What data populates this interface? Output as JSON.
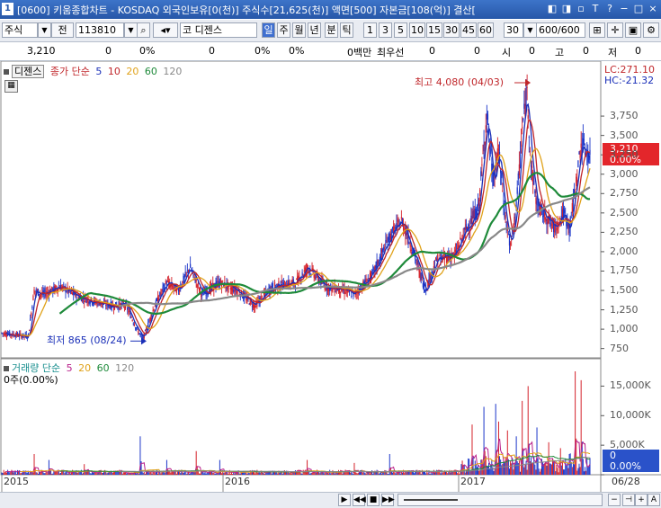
{
  "titlebar": {
    "number": "1",
    "title": "[0600] 키움종합차트 - KOSDAQ 외국인보유[0(천)] 주식수[21,625(천)] 액면[500] 자본금[108(억)] 결산[",
    "buttons": [
      "◧",
      "◨",
      "▫",
      "T",
      "?",
      "−",
      "□",
      "×"
    ]
  },
  "toolbar": {
    "market_select": "주식",
    "period_label": "전",
    "code": "113810",
    "stock_name": "코 디젠스",
    "intervals": [
      "일",
      "주",
      "월",
      "년",
      "분",
      "틱"
    ],
    "minutes": [
      "1",
      "3",
      "5",
      "10",
      "15",
      "30",
      "45",
      "60"
    ],
    "count_select": "30",
    "range": "600/600"
  },
  "infobar": {
    "price": "3,210",
    "v1": "0",
    "p1": "0%",
    "v2": "0",
    "p2": "0%",
    "p3": "0%",
    "unit": "0백만",
    "best_label": "최우선",
    "v3": "0",
    "v4": "0",
    "open_label": "시",
    "open_val": "0",
    "high_label": "고",
    "high_val": "0",
    "low_label": "저",
    "low_val": "0"
  },
  "price_panel": {
    "stock_tab": "디젠스",
    "legend_prefix": "종가 단순",
    "ma": [
      {
        "period": "5",
        "color": "#1a2fb8"
      },
      {
        "period": "10",
        "color": "#c0262a"
      },
      {
        "period": "20",
        "color": "#e0a21a"
      },
      {
        "period": "60",
        "color": "#1e8a3a"
      },
      {
        "period": "120",
        "color": "#888888"
      }
    ],
    "lc": "LC:271.10",
    "hc": "HC:-21.32",
    "current_price": "3,210",
    "current_pct": "0.00%",
    "high_note": "최고 4,080 (04/03)",
    "low_note": "최저 865 (08/24)"
  },
  "volume_panel": {
    "legend_prefix": "거래량 단순",
    "ma": [
      {
        "period": "5",
        "color": "#b81f8a"
      },
      {
        "period": "20",
        "color": "#e0a21a"
      },
      {
        "period": "60",
        "color": "#1e8a3a"
      },
      {
        "period": "120",
        "color": "#888888"
      }
    ],
    "current": "0주(0.00%)",
    "current_box": "0",
    "current_pct_box": "0.00%"
  },
  "xaxis": {
    "labels": [
      "2015",
      "2016",
      "2017"
    ],
    "last_date": "06/28"
  },
  "chart_data": {
    "type": "line",
    "price_ticks": [
      750,
      1000,
      1250,
      1500,
      1750,
      2000,
      2250,
      2500,
      2750,
      3000,
      3250,
      3500,
      3750
    ],
    "price_tick_labels": [
      "750",
      "1,000",
      "1,250",
      "1,500",
      "1,750",
      "2,000",
      "2,250",
      "2,500",
      "2,750",
      "3,000",
      "3,250",
      "3,500",
      "3,750"
    ],
    "ylim": [
      630,
      4250
    ],
    "volume_ticks": [
      0,
      5000,
      10000,
      15000
    ],
    "volume_tick_labels": [
      "0",
      "5,000K",
      "10,000K",
      "15,000K"
    ],
    "vol_ylim": [
      0,
      17500
    ],
    "price_anchors": [
      [
        0,
        950
      ],
      [
        0.02,
        930
      ],
      [
        0.045,
        910
      ],
      [
        0.055,
        1500
      ],
      [
        0.07,
        1450
      ],
      [
        0.1,
        1550
      ],
      [
        0.13,
        1420
      ],
      [
        0.16,
        1350
      ],
      [
        0.19,
        1300
      ],
      [
        0.21,
        1320
      ],
      [
        0.23,
        1000
      ],
      [
        0.24,
        870
      ],
      [
        0.26,
        1300
      ],
      [
        0.28,
        1600
      ],
      [
        0.3,
        1500
      ],
      [
        0.32,
        1800
      ],
      [
        0.34,
        1450
      ],
      [
        0.37,
        1600
      ],
      [
        0.4,
        1500
      ],
      [
        0.43,
        1300
      ],
      [
        0.46,
        1550
      ],
      [
        0.5,
        1600
      ],
      [
        0.52,
        1800
      ],
      [
        0.55,
        1550
      ],
      [
        0.58,
        1500
      ],
      [
        0.6,
        1450
      ],
      [
        0.63,
        1700
      ],
      [
        0.66,
        2200
      ],
      [
        0.68,
        2400
      ],
      [
        0.7,
        2000
      ],
      [
        0.72,
        1500
      ],
      [
        0.74,
        1900
      ],
      [
        0.77,
        1950
      ],
      [
        0.79,
        2300
      ],
      [
        0.81,
        2550
      ],
      [
        0.825,
        3800
      ],
      [
        0.835,
        2900
      ],
      [
        0.845,
        3300
      ],
      [
        0.855,
        2500
      ],
      [
        0.865,
        2050
      ],
      [
        0.875,
        2600
      ],
      [
        0.885,
        3600
      ],
      [
        0.893,
        4080
      ],
      [
        0.9,
        3100
      ],
      [
        0.91,
        2600
      ],
      [
        0.925,
        2450
      ],
      [
        0.94,
        2300
      ],
      [
        0.955,
        2500
      ],
      [
        0.965,
        2300
      ],
      [
        0.975,
        2800
      ],
      [
        0.985,
        3400
      ],
      [
        1.0,
        3210
      ]
    ],
    "volume_spikes": [
      [
        0.055,
        3500
      ],
      [
        0.08,
        2500
      ],
      [
        0.14,
        1800
      ],
      [
        0.235,
        6500
      ],
      [
        0.28,
        2500
      ],
      [
        0.33,
        4000
      ],
      [
        0.37,
        2500
      ],
      [
        0.52,
        2500
      ],
      [
        0.6,
        2000
      ],
      [
        0.66,
        3500
      ],
      [
        0.8,
        8500
      ],
      [
        0.82,
        11500
      ],
      [
        0.84,
        12000
      ],
      [
        0.845,
        9000
      ],
      [
        0.86,
        7500
      ],
      [
        0.875,
        6500
      ],
      [
        0.885,
        12500
      ],
      [
        0.895,
        15000
      ],
      [
        0.91,
        8000
      ],
      [
        0.93,
        5500
      ],
      [
        0.95,
        4500
      ],
      [
        0.965,
        3500
      ],
      [
        0.975,
        17500
      ],
      [
        0.985,
        16000
      ]
    ],
    "series": [
      {
        "period": 5,
        "color": "#1a2fb8",
        "values": []
      },
      {
        "period": 10,
        "color": "#c0262a",
        "values": []
      },
      {
        "period": 20,
        "color": "#e0a21a",
        "values": []
      },
      {
        "period": 60,
        "color": "#1e8a3a",
        "values": []
      },
      {
        "period": 120,
        "color": "#888888",
        "values": []
      }
    ]
  }
}
